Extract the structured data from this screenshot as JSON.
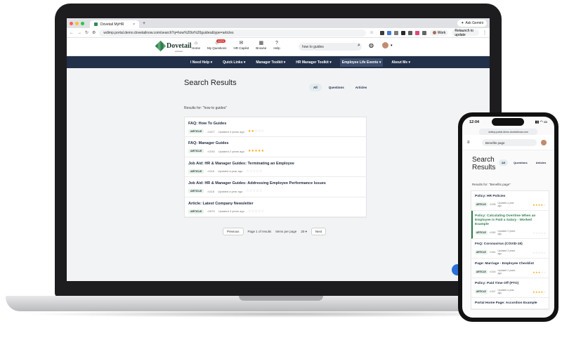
{
  "browser": {
    "tab_title": "Dovetail MyHR",
    "tab_close": "×",
    "new_tab": "+",
    "ask_gemini": "Ask Gemini",
    "url": "wdimp.portal.demo.dovetailnow.com/search?q=how%20to%20guides&type=articles",
    "profile": "Work",
    "relaunch": "Relaunch to update",
    "colors": {
      "close": "#ff5f57",
      "min": "#febc2e",
      "max": "#28c840"
    }
  },
  "header": {
    "logo_text": "Dovetail",
    "logo_sub": "software",
    "nav": [
      {
        "icon": "⌂",
        "label": "Home"
      },
      {
        "icon": "☺",
        "label": "My Questions",
        "badge": "1173"
      },
      {
        "icon": "✉",
        "label": "HR Capilot"
      },
      {
        "icon": "▦",
        "label": "Browse"
      },
      {
        "icon": "?",
        "label": "Help"
      }
    ],
    "search_value": "how to guides"
  },
  "mainnav": [
    "I Need Help ▾",
    "Quick Links ▾",
    "Manager Toolkit ▾",
    "HR Manager Toolkit ▾",
    "Employee Life Events ▾",
    "About Me ▾"
  ],
  "search": {
    "title": "Search Results",
    "filters": [
      "All",
      "Questions",
      "Articles"
    ],
    "results_for": "Results for: \"how to guides\"",
    "results": [
      {
        "title": "FAQ: How To Guides",
        "type": "ARTICLE",
        "id": "r1027",
        "updated": "Updated 3 years ago",
        "rating": 2
      },
      {
        "title": "FAQ: Manager Guides",
        "type": "ARTICLE",
        "id": "r1030",
        "updated": "Updated 2 years ago",
        "rating": 5
      },
      {
        "title": "Job Aid: HR & Manager Guides: Terminating an Employee",
        "type": "ARTICLE",
        "id": "r1116",
        "updated": "Updated a year ago",
        "rating": 0
      },
      {
        "title": "Job Aid: HR & Manager Guides: Addressing Employee Performance Issues",
        "type": "ARTICLE",
        "id": "r1118",
        "updated": "Updated a year ago",
        "rating": 0
      },
      {
        "title": "Article: Latest Company Newsletter",
        "type": "ARTICLE",
        "id": "r1875",
        "updated": "Updated 3 years ago",
        "rating": 0
      }
    ],
    "pager": {
      "prev": "Previous",
      "page": "Page 1 of results",
      "items_label": "Items per page",
      "items_value": "20 ▾",
      "next": "Next"
    }
  },
  "phone": {
    "time": "12:04",
    "signal": "▮▮ ◠ ▭",
    "url": "wdimp.portal.demo.dovetailnow.com",
    "search_value": "Benefits page",
    "title": "Search Results",
    "filters": [
      "All",
      "Questions",
      "Articles"
    ],
    "results_for": "Results for: \"Benefits page\"",
    "results": [
      {
        "title": "Policy: HR Policies",
        "type": "ARTICLE",
        "id": "r1036",
        "updated": "Updated a year ago",
        "rating": 4,
        "active": false
      },
      {
        "title": "Policy: Calculating Overtime When an Employee is Paid a Salary - Worked Example",
        "type": "ARTICLE",
        "id": "r1062",
        "updated": "Updated 2 years ago",
        "rating": 0,
        "active": true
      },
      {
        "title": "FAQ: Coronavirus (COVID-19)",
        "type": "ARTICLE",
        "id": "r1061",
        "updated": "Updated 3 years ago",
        "rating": 0,
        "active": false
      },
      {
        "title": "Page: Marriage - Employee Checklist",
        "type": "ARTICLE",
        "id": "r1040",
        "updated": "Updated 2 years ago",
        "rating": 3,
        "active": false
      },
      {
        "title": "Policy: Paid Time Off (PTO)",
        "type": "ARTICLE",
        "id": "r1047",
        "updated": "Updated a year ago",
        "rating": 4,
        "active": false
      },
      {
        "title": "Portal Home Page: Accordion Example",
        "type": "",
        "id": "",
        "updated": "",
        "rating": 0,
        "active": false
      }
    ]
  }
}
